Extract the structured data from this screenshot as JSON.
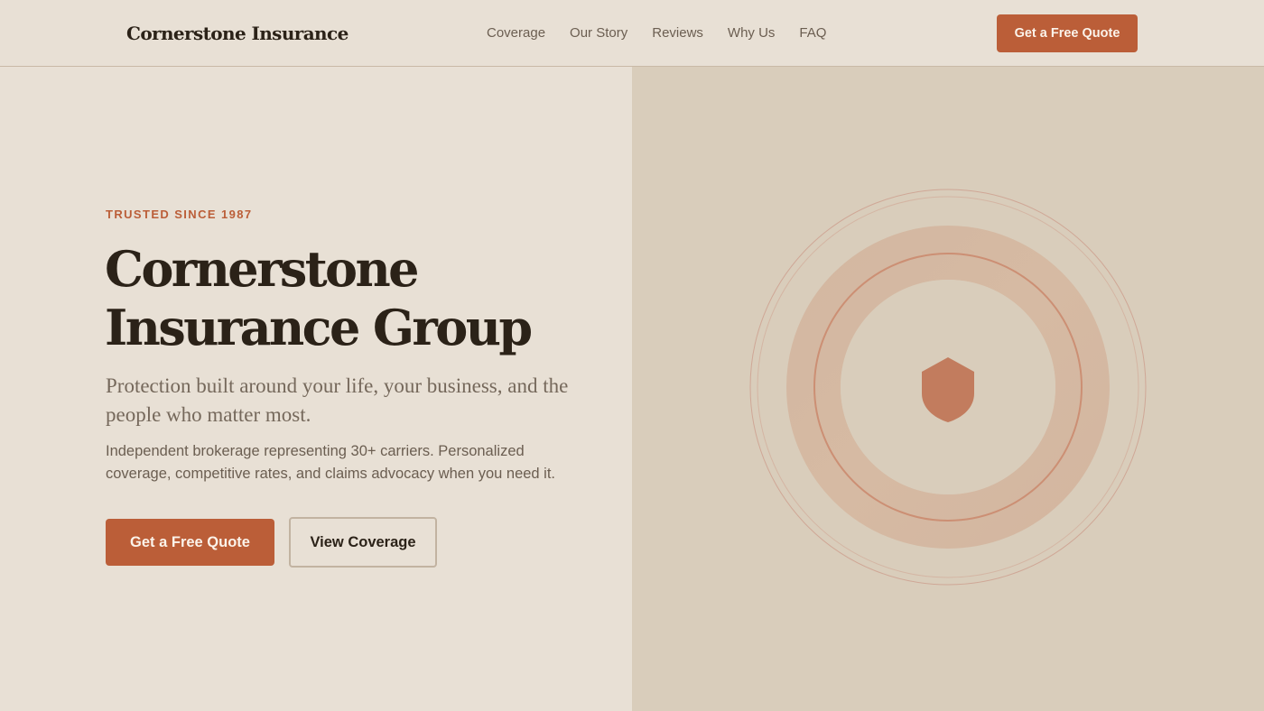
{
  "nav": {
    "brand": "Cornerstone Insurance",
    "links": [
      "Coverage",
      "Our Story",
      "Reviews",
      "Why Us",
      "FAQ"
    ],
    "cta_label": "Get a Free Quote"
  },
  "hero": {
    "eyebrow": "TRUSTED SINCE 1987",
    "title_line1": "Cornerstone",
    "title_line2": "Insurance Group",
    "subtitle": "Protection built around your life, your business, and the people who matter most.",
    "body": "Independent brokerage representing 30+ carriers. Personalized coverage, competitive rates, and claims advocacy when you need it.",
    "primary_button": "Get a Free Quote",
    "secondary_button": "View Coverage"
  },
  "illustration": {
    "icon": "shield-icon"
  },
  "colors": {
    "accent": "#bb5e38",
    "background": "#e8e0d5",
    "panel": "#d9cdbb",
    "text": "#2b2218",
    "muted": "#6b5e51"
  }
}
